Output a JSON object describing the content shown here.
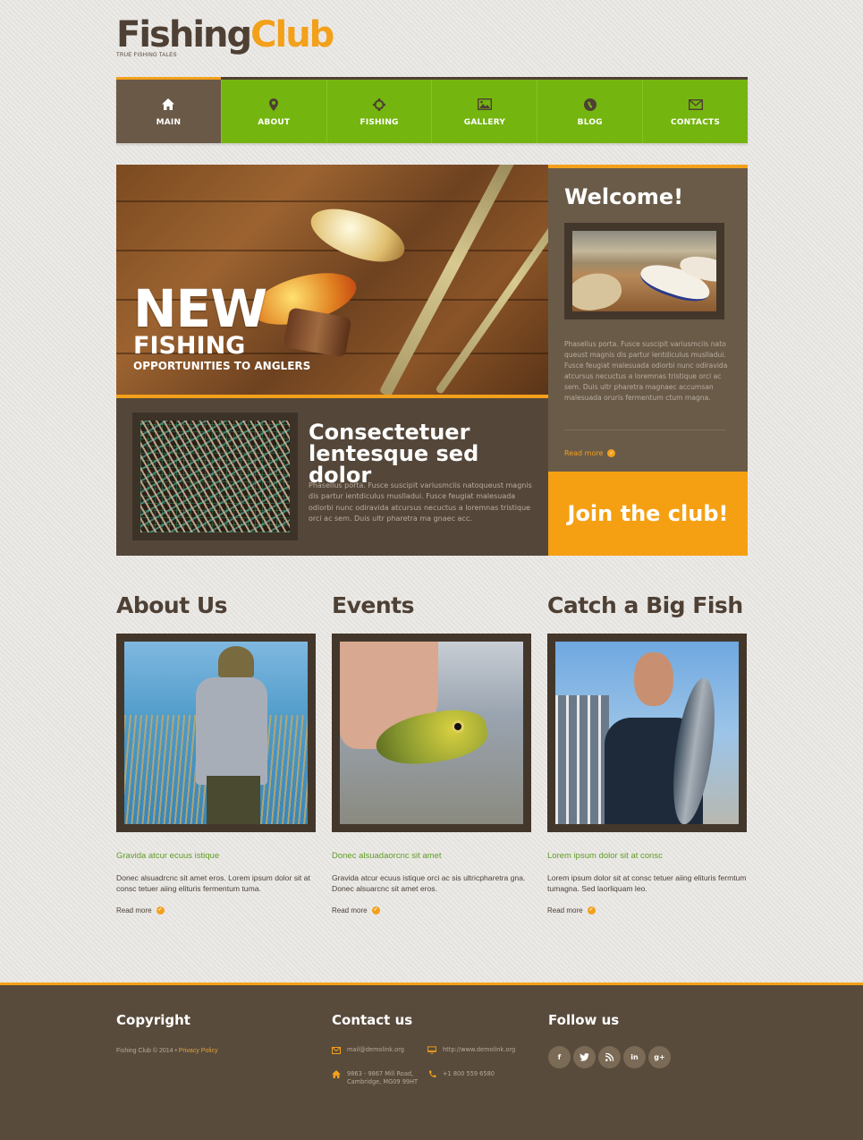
{
  "header": {
    "logo_part1": "Fishing",
    "logo_part2": "Club",
    "tagline": "TRUE FISHING TALES"
  },
  "colors": {
    "accent_orange": "#f3a01a",
    "nav_green": "#74b50f",
    "brown_dark": "#584b3c",
    "brown_mid": "#6a5b49",
    "subtitle_green": "#5f9c24"
  },
  "nav": {
    "items": [
      {
        "label": "MAIN",
        "icon": "home-icon",
        "active": true
      },
      {
        "label": "ABOUT",
        "icon": "map-pin-icon",
        "active": false
      },
      {
        "label": "FISHING",
        "icon": "crosshair-icon",
        "active": false
      },
      {
        "label": "GALLERY",
        "icon": "image-icon",
        "active": false
      },
      {
        "label": "BLOG",
        "icon": "globe-icon",
        "active": false
      },
      {
        "label": "CONTACTS",
        "icon": "envelope-icon",
        "active": false
      }
    ]
  },
  "hero": {
    "big": "NEW",
    "mid": "FISHING",
    "sub": "OPPORTUNITIES TO ANGLERS",
    "lower_title": "Consectetuer lentesque sed dolor",
    "lower_text": "Phasellus porta. Fusce suscipit variusmciis natoqueust magnis dis partur ientdiculus muslladui. Fusce feugiat malesuada odiorbi nunc odiravida atcursus necuctus a loremnas tristique orci ac sem. Duis ultr pharetra ma gnaec acc."
  },
  "welcome": {
    "title": "Welcome!",
    "text": "Phasellus porta. Fusce suscipit variusmciis nato queust magnis dis partur lentdiculus muslladui. Fusce feugiat malesuada odiorbi nunc odiravida atcursus necuctus a loremnas tristique orci ac sem. Duis ultr pharetra magnaec accumsan malesuada oruris fermentum ctum magna.",
    "read_more": "Read more"
  },
  "join": {
    "label": "Join the club!"
  },
  "columns": [
    {
      "title": "About Us",
      "subtitle": "Gravida atcur ecuus istique",
      "text": "Donec alsuadrcnc sit amet eros. Lorem ipsum dolor sit at consc tetuer aiing elituris fermentum tuma.",
      "read_more": "Read more"
    },
    {
      "title": "Events",
      "subtitle": "Donec alsuadaorcnc sit amet",
      "text": "Gravida atcur ecuus istique orci ac sis ultricpharetra gna. Donec alsuarcnc sit amet eros.",
      "read_more": "Read more"
    },
    {
      "title": "Catch a Big Fish",
      "subtitle": "Lorem ipsum dolor sit at consc",
      "text": "Lorem ipsum dolor sit at consc tetuer aiing elituris fermtum tumagna. Sed laorliquam leo.",
      "read_more": "Read more"
    }
  ],
  "footer": {
    "copyright": {
      "title": "Copyright",
      "text": "Fishing Club © 2014 • ",
      "privacy": "Privacy Policy"
    },
    "contact": {
      "title": "Contact us",
      "email": "mail@demolink.org",
      "website": "http://www.demolink.org",
      "address_line1": "9863 - 9867 Mill Road,",
      "address_line2": "Cambridge, MG09 99HT",
      "phone": "+1 800 559 6580"
    },
    "follow": {
      "title": "Follow us",
      "socials": [
        {
          "name": "facebook",
          "glyph": "f"
        },
        {
          "name": "twitter",
          "glyph": "t"
        },
        {
          "name": "rss",
          "glyph": "⋰"
        },
        {
          "name": "linkedin",
          "glyph": "in"
        },
        {
          "name": "google-plus",
          "glyph": "g+"
        }
      ]
    }
  }
}
